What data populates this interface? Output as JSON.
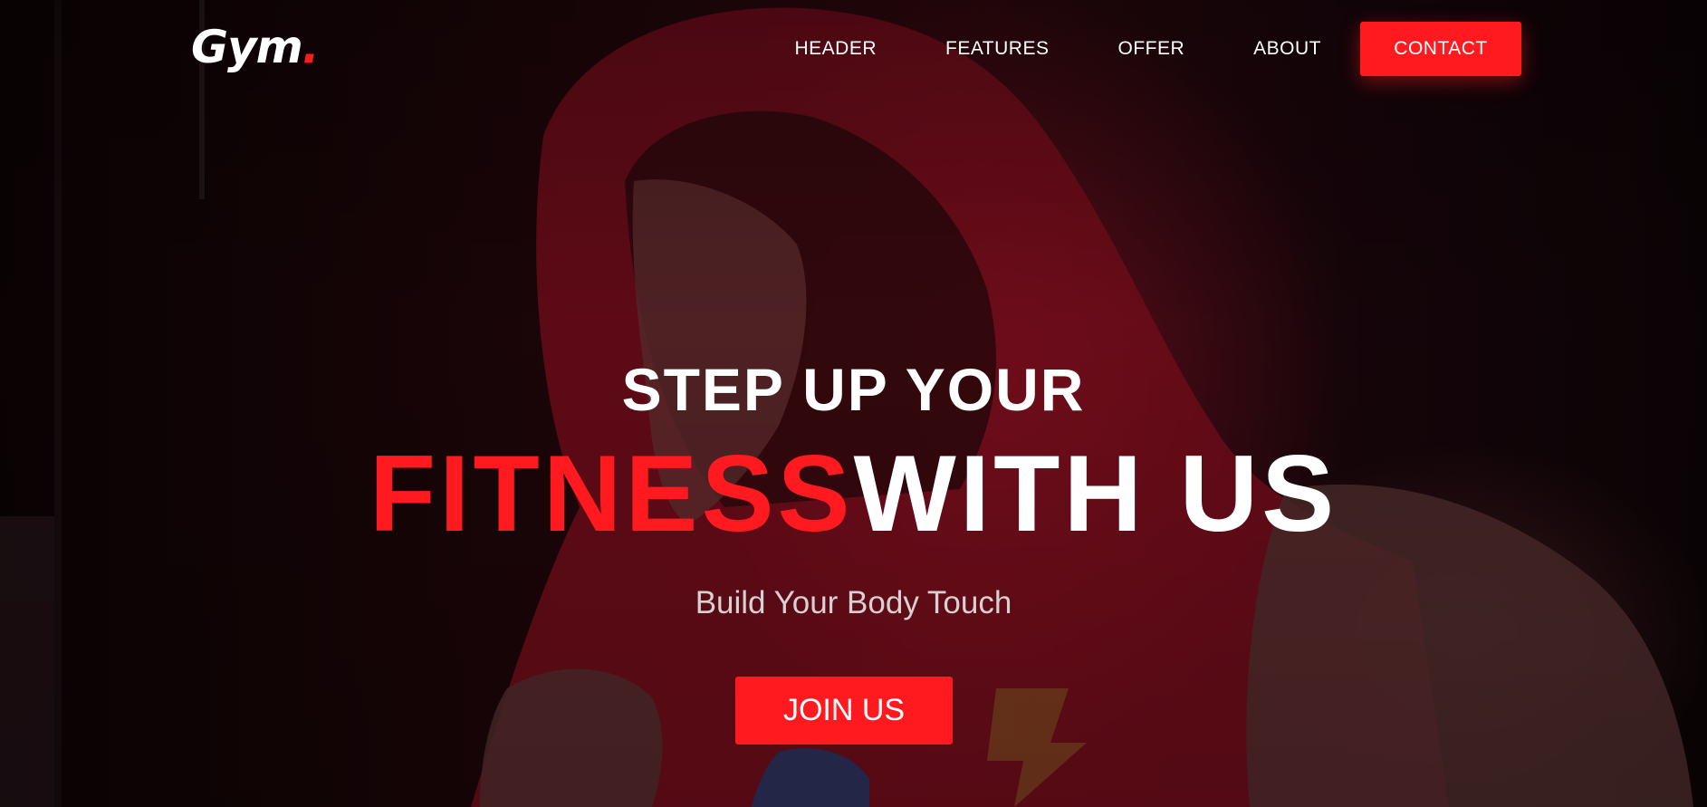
{
  "brand": {
    "logo_text": "Gym",
    "logo_dot": ".",
    "accent": "#ff1a1f"
  },
  "nav": {
    "items": [
      {
        "label": "HEADER"
      },
      {
        "label": "FEATURES"
      },
      {
        "label": "OFFER"
      },
      {
        "label": "ABOUT"
      }
    ],
    "contact_label": "CONTACT"
  },
  "hero": {
    "background_image": "hooded-boxer-photo",
    "line1": "STEP UP YOUR",
    "line2_highlight": "FITNESS",
    "line2_rest": "WITH US",
    "tagline": "Build Your Body Touch",
    "cta_label": "JOIN US"
  },
  "colors": {
    "accent": "#ff1a1f",
    "text": "#ffffff",
    "background": "#0c0305"
  }
}
